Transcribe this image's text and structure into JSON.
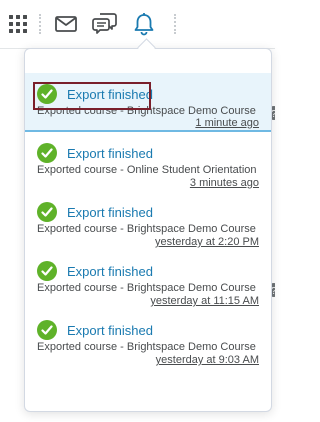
{
  "toolbar": {
    "icons": [
      "grid-icon",
      "mail-icon",
      "chat-icon",
      "bell-icon"
    ]
  },
  "notifications": [
    {
      "title": "Export finished",
      "description": "Exported course - Brightspace Demo Course",
      "time": "1 minute ago",
      "highlighted": true
    },
    {
      "title": "Export finished",
      "description": "Exported course - Online Student Orientation",
      "time": "3 minutes ago",
      "highlighted": false
    },
    {
      "title": "Export finished",
      "description": "Exported course - Brightspace Demo Course",
      "time": "yesterday at 2:20 PM",
      "highlighted": false
    },
    {
      "title": "Export finished",
      "description": "Exported course - Brightspace Demo Course",
      "time": "yesterday at 11:15 AM",
      "highlighted": false
    },
    {
      "title": "Export finished",
      "description": "Exported course - Brightspace Demo Course",
      "time": "yesterday at 9:03 AM",
      "highlighted": false
    }
  ],
  "colors": {
    "accent": "#1a7ab0",
    "success": "#5fb229",
    "highlight_bg": "#e8f4fb",
    "focus_ring": "#7a1f2b"
  }
}
